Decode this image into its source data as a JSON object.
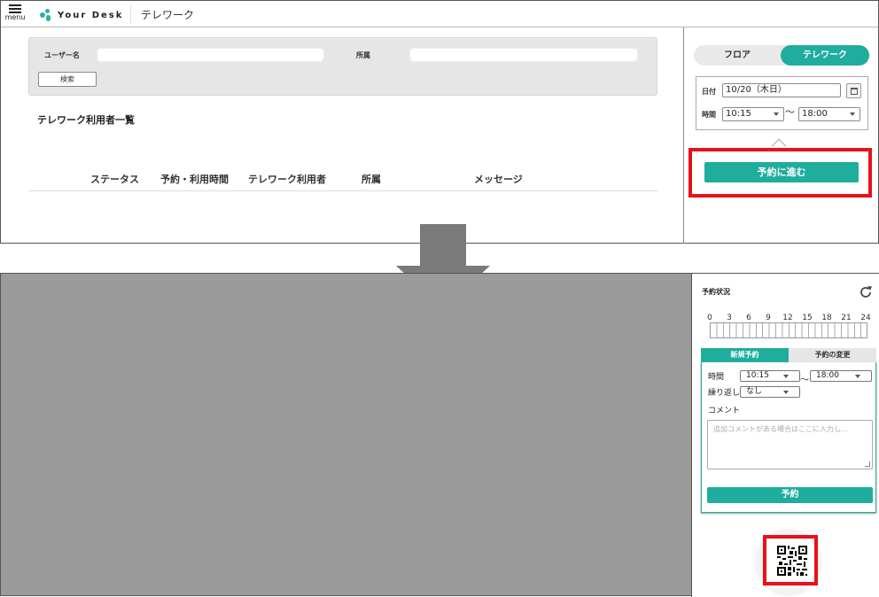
{
  "header": {
    "menu_label": "menu",
    "logo_text": "Your Desk",
    "page_title": "テレワーク"
  },
  "search": {
    "user_label": "ユーザー名",
    "user_value": "",
    "dept_label": "所属",
    "dept_value": "",
    "button_label": "検索"
  },
  "list": {
    "title": "テレワーク利用者一覧",
    "columns": [
      "ステータス",
      "予約・利用時間",
      "テレワーク利用者",
      "所属",
      "メッセージ"
    ]
  },
  "side_panel": {
    "tabs": [
      "フロア",
      "テレワーク"
    ],
    "active_tab": "テレワーク",
    "date_label": "日付",
    "date_value": "10/20（木日）",
    "time_label": "時間",
    "time_start": "10:15",
    "time_end": "18:00",
    "tilde": "〜",
    "proceed_label": "予約に進む"
  },
  "reservation": {
    "status_title": "予約状況",
    "hour_ticks": [
      "0",
      "3",
      "6",
      "9",
      "12",
      "15",
      "18",
      "21",
      "24"
    ],
    "tab_new": "新規予約",
    "tab_change": "予約の変更",
    "time_label": "時間",
    "time_start": "10:15",
    "time_end": "18:00",
    "tilde": "〜",
    "repeat_label": "繰り返し",
    "repeat_value": "なし",
    "comment_label": "コメント",
    "comment_placeholder": "追加コメントがある場合はここに入力し…",
    "reserve_label": "予約"
  },
  "colors": {
    "accent": "#1fad9d",
    "highlight": "#e8111b",
    "overlay": "#9b9b9b",
    "arrow": "#7a7a7a"
  }
}
